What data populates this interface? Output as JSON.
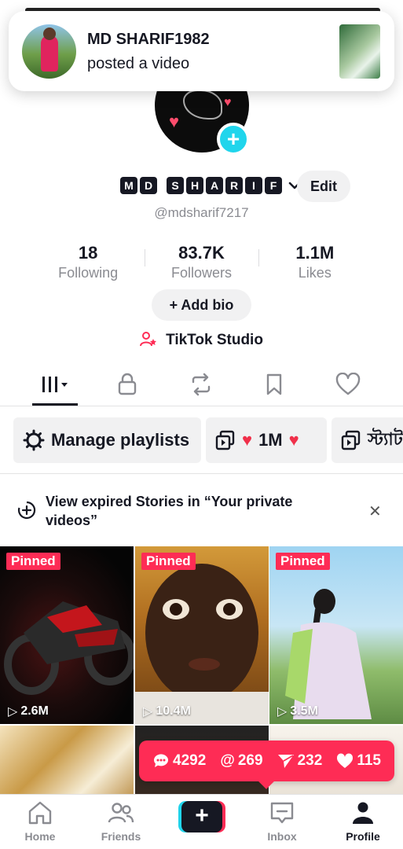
{
  "notification": {
    "name": "MD SHARIF1982",
    "text": "posted a video"
  },
  "profile": {
    "display_name_chars": [
      "M",
      "D",
      " ",
      "S",
      "H",
      "A",
      "R",
      "I",
      "F"
    ],
    "edit_label": "Edit",
    "handle": "@mdsharif7217",
    "stats": [
      {
        "value": "18",
        "label": "Following"
      },
      {
        "value": "83.7K",
        "label": "Followers"
      },
      {
        "value": "1.1M",
        "label": "Likes"
      }
    ],
    "add_bio_label": "+ Add bio",
    "studio_label": "TikTok Studio"
  },
  "tabs": [
    "videos-grid",
    "private",
    "reposts",
    "favorites",
    "liked"
  ],
  "playlists": [
    {
      "label": "Manage playlists"
    },
    {
      "label": "1M"
    },
    {
      "label": "স্ট্যাট"
    }
  ],
  "stories_banner": {
    "text": "View expired Stories in “Your private videos”"
  },
  "videos": [
    {
      "pinned": "Pinned",
      "views": "2.6M"
    },
    {
      "pinned": "Pinned",
      "views": "10.4M"
    },
    {
      "pinned": "Pinned",
      "views": "3.5M"
    }
  ],
  "activity_toast": {
    "comments": "4292",
    "mentions": "269",
    "shares": "232",
    "likes": "115"
  },
  "bottom_nav": {
    "home": "Home",
    "friends": "Friends",
    "inbox": "Inbox",
    "profile": "Profile"
  },
  "colors": {
    "accent_red": "#fe2c55",
    "accent_cyan": "#20d5ec",
    "text_primary": "#161823",
    "text_secondary": "#8a8b91"
  }
}
